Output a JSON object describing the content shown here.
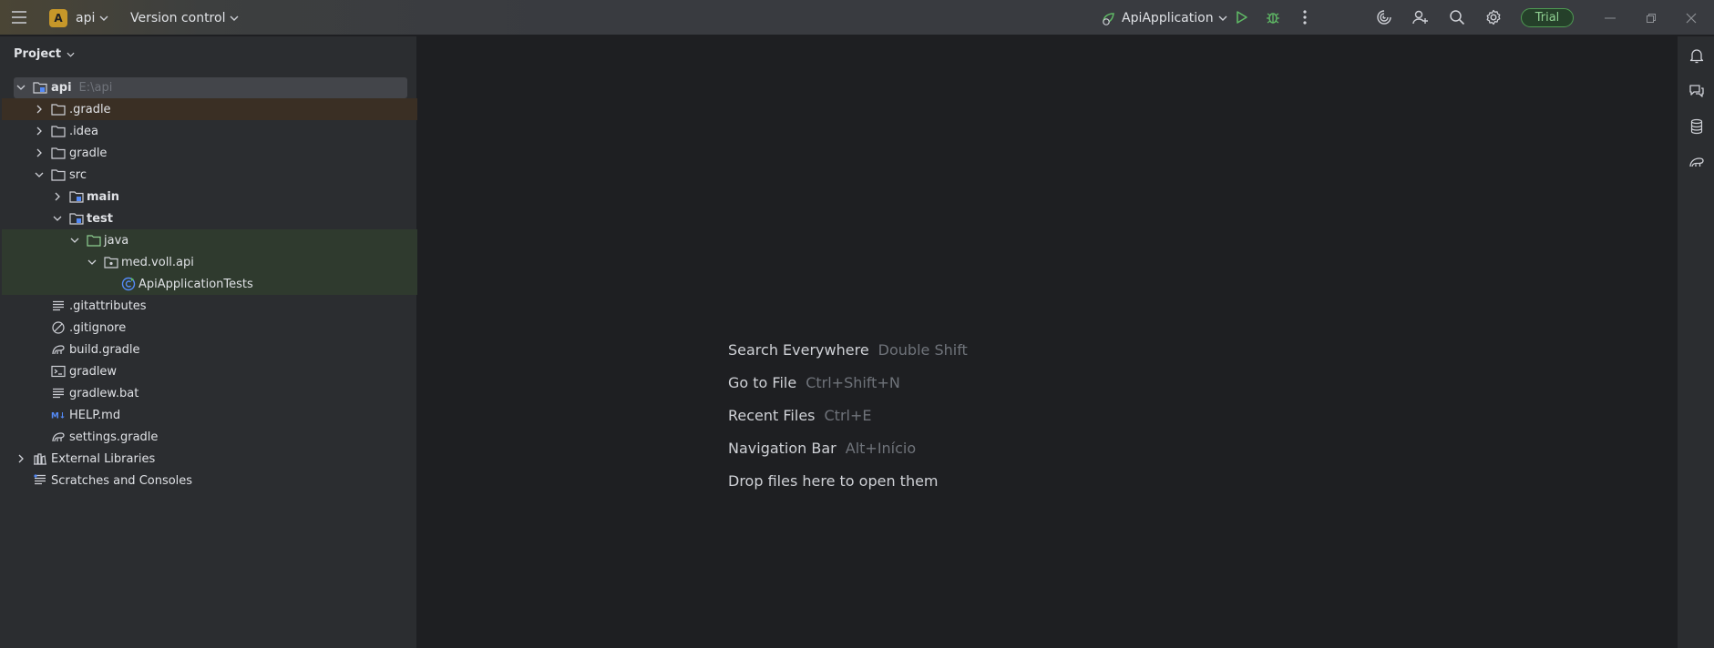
{
  "titlebar": {
    "project_badge": "A",
    "project_name": "api",
    "vcs_label": "Version control",
    "run_config": "ApiApplication",
    "trial_label": "Trial",
    "icons": [
      "hamburger-menu-icon",
      "run-config-icon",
      "run-icon",
      "debug-icon",
      "more-vertical-icon",
      "ai-assistant-icon",
      "add-user-icon",
      "search-icon",
      "settings-gear-icon",
      "minimize-icon",
      "maximize-icon",
      "close-icon"
    ]
  },
  "project_panel": {
    "title": "Project",
    "tree": [
      {
        "name": "api",
        "hint": "E:\\api",
        "expanded": true,
        "icon": "module-folder-icon"
      },
      {
        "name": ".gradle",
        "expanded": false,
        "icon": "folder-icon"
      },
      {
        "name": ".idea",
        "expanded": false,
        "icon": "folder-icon"
      },
      {
        "name": "gradle",
        "expanded": false,
        "icon": "folder-icon"
      },
      {
        "name": "src",
        "expanded": true,
        "icon": "folder-icon"
      },
      {
        "name": "main",
        "expanded": false,
        "icon": "source-folder-icon"
      },
      {
        "name": "test",
        "expanded": true,
        "icon": "test-folder-icon"
      },
      {
        "name": "java",
        "expanded": true,
        "icon": "test-root-folder-icon"
      },
      {
        "name": "med.voll.api",
        "expanded": true,
        "icon": "package-icon"
      },
      {
        "name": "ApiApplicationTests",
        "icon": "test-class-icon"
      },
      {
        "name": ".gitattributes",
        "icon": "text-file-icon"
      },
      {
        "name": ".gitignore",
        "icon": "ignore-file-icon"
      },
      {
        "name": "build.gradle",
        "icon": "gradle-file-icon"
      },
      {
        "name": "gradlew",
        "icon": "shell-script-icon"
      },
      {
        "name": "gradlew.bat",
        "icon": "text-file-icon"
      },
      {
        "name": "HELP.md",
        "icon": "markdown-icon"
      },
      {
        "name": "settings.gradle",
        "icon": "gradle-file-icon"
      },
      {
        "name": "External Libraries",
        "expanded": false,
        "icon": "libraries-icon"
      },
      {
        "name": "Scratches and Consoles",
        "icon": "scratches-icon"
      }
    ]
  },
  "editor_empty": {
    "hints": [
      {
        "label": "Search Everywhere",
        "shortcut": "Double Shift"
      },
      {
        "label": "Go to File",
        "shortcut": "Ctrl+Shift+N"
      },
      {
        "label": "Recent Files",
        "shortcut": "Ctrl+E"
      },
      {
        "label": "Navigation Bar",
        "shortcut": "Alt+Início"
      },
      {
        "label": "Drop files here to open them",
        "shortcut": ""
      }
    ]
  },
  "right_strip": {
    "icons": [
      "notifications-icon",
      "ai-chat-icon",
      "database-icon",
      "gradle-icon"
    ]
  },
  "colors": {
    "background": "#1e1f22",
    "panel": "#2b2d30",
    "accent_green": "#5fb865",
    "badge": "#c69729"
  }
}
